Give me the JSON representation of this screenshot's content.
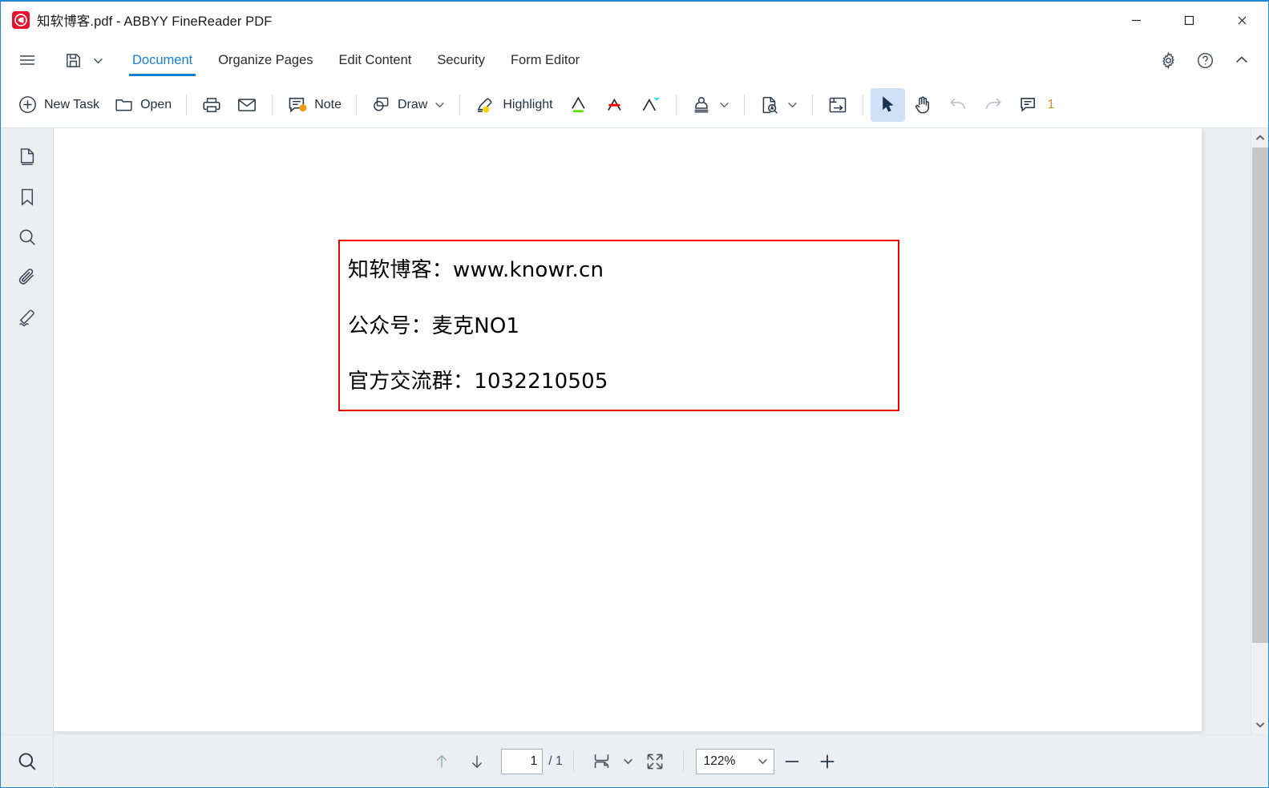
{
  "window": {
    "title": "知软博客.pdf - ABBYY FineReader PDF",
    "logo_icon": "abbyy-logo-icon",
    "accent_color": "#1a7fd4",
    "logo_color": "#e8112d",
    "controls": [
      {
        "name": "minimize",
        "icon": "minimize-icon"
      },
      {
        "name": "maximize",
        "icon": "maximize-icon"
      },
      {
        "name": "close",
        "icon": "close-icon"
      }
    ]
  },
  "menubar": {
    "hamburger_icon": "hamburger-menu-icon",
    "save_icon": "save-icon",
    "save_chevron_icon": "chevron-down-icon",
    "tabs": [
      {
        "label": "Document",
        "active": true
      },
      {
        "label": "Organize Pages",
        "active": false
      },
      {
        "label": "Edit Content",
        "active": false
      },
      {
        "label": "Security",
        "active": false
      },
      {
        "label": "Form Editor",
        "active": false
      }
    ],
    "right_buttons": [
      {
        "name": "settings",
        "icon": "gear-icon"
      },
      {
        "name": "help",
        "icon": "question-circle-icon"
      },
      {
        "name": "collapse-ribbon",
        "icon": "chevron-up-icon"
      }
    ]
  },
  "toolbar": {
    "new_task_label": "New Task",
    "open_label": "Open",
    "note_label": "Note",
    "draw_label": "Draw",
    "highlight_label": "Highlight",
    "comment_count": "1",
    "icons": {
      "new_task": "plus-circle-icon",
      "open": "folder-icon",
      "print": "printer-icon",
      "email": "envelope-icon",
      "note": "note-comment-icon",
      "draw": "draw-shapes-icon",
      "highlight": "highlighter-icon",
      "underline": "underline-text-icon",
      "strikethrough": "strikethrough-text-icon",
      "insert_text": "insert-text-icon",
      "stamp": "stamp-icon",
      "ocr": "ocr-document-icon",
      "convert": "convert-export-icon",
      "select": "cursor-arrow-icon",
      "hand": "hand-pan-icon",
      "undo": "undo-icon",
      "redo": "redo-icon",
      "comments": "comments-panel-icon"
    },
    "colors": {
      "underline": "#5fdd00",
      "strikethrough": "#ff0000",
      "insert": "#00d8f0",
      "note_dot": "#f59b11",
      "highlight_dot": "#ffd400",
      "comment_count": "#d98c23",
      "selected_bg": "#cfe0f7"
    }
  },
  "sidebar": {
    "items": [
      {
        "name": "pages",
        "icon": "page-thumbnails-icon"
      },
      {
        "name": "bookmarks",
        "icon": "bookmark-icon"
      },
      {
        "name": "search",
        "icon": "search-icon"
      },
      {
        "name": "attachments",
        "icon": "paperclip-icon"
      },
      {
        "name": "signatures",
        "icon": "signature-pen-icon"
      }
    ]
  },
  "document": {
    "annotation_border_color": "#ee0000",
    "lines": [
      "知软博客：www.knowr.cn",
      "公众号：麦克NO1",
      "官方交流群：1032210505"
    ]
  },
  "scrollbar": {
    "up_icon": "chevron-up-icon",
    "down_icon": "chevron-down-icon"
  },
  "statusbar": {
    "search_icon": "search-icon",
    "prev_page_icon": "arrow-up-icon",
    "next_page_icon": "arrow-down-icon",
    "page_number": "1",
    "page_total": "/ 1",
    "page_layout_icon": "page-layout-icon",
    "page_layout_chevron_icon": "chevron-down-icon",
    "fit_page_icon": "fit-page-icon",
    "zoom_value": "122%",
    "zoom_chevron_icon": "chevron-down-icon",
    "zoom_out_icon": "minus-icon",
    "zoom_in_icon": "plus-icon"
  }
}
